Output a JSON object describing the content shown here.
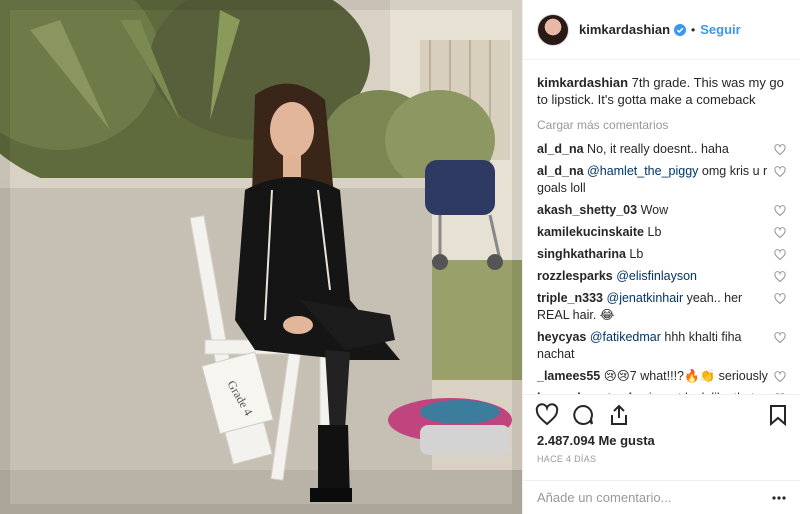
{
  "post": {
    "username": "kimkardashian",
    "follow_label": "Seguir",
    "separator": "•",
    "caption_text": "7th grade. This was my go to lipstick. It's gotta make a comeback",
    "load_more": "Cargar más comentarios",
    "likes": "2.487.094 Me gusta",
    "time_ago": "HACE 4 DÍAS",
    "comment_placeholder": "Añade un comentario...",
    "photo_sign": "Grade 4"
  },
  "comments": [
    {
      "user": "al_d_na",
      "mention": "",
      "text": "No, it really doesnt.. haha"
    },
    {
      "user": "al_d_na",
      "mention": "@hamlet_the_piggy",
      "text": "omg kris u r goals loll"
    },
    {
      "user": "akash_shetty_03",
      "mention": "",
      "text": "Wow"
    },
    {
      "user": "kamilekucinskaite",
      "mention": "",
      "text": "Lb"
    },
    {
      "user": "singhkatharina",
      "mention": "",
      "text": "Lb"
    },
    {
      "user": "rozzlesparks",
      "mention": "@elisfinlayson",
      "text": ""
    },
    {
      "user": "triple_n333",
      "mention": "@jenatkinhair",
      "text": "yeah.. her REAL hair. 😂"
    },
    {
      "user": "heycyas",
      "mention": "@fatikedmar",
      "text": "hhh khalti fiha nachat"
    },
    {
      "user": "_lamees55",
      "mention": "",
      "text": "😢😢7 what!!!?🔥👏 seriously"
    },
    {
      "user": "hanna.lenartowicz",
      "mention": "",
      "text": "i want look like that"
    }
  ],
  "colors": {
    "accent": "#3897f0",
    "mention": "#003569",
    "muted": "#999999"
  },
  "icons": [
    "verified-badge-icon",
    "heart-icon",
    "comment-icon",
    "share-icon",
    "bookmark-icon",
    "more-options-icon"
  ]
}
